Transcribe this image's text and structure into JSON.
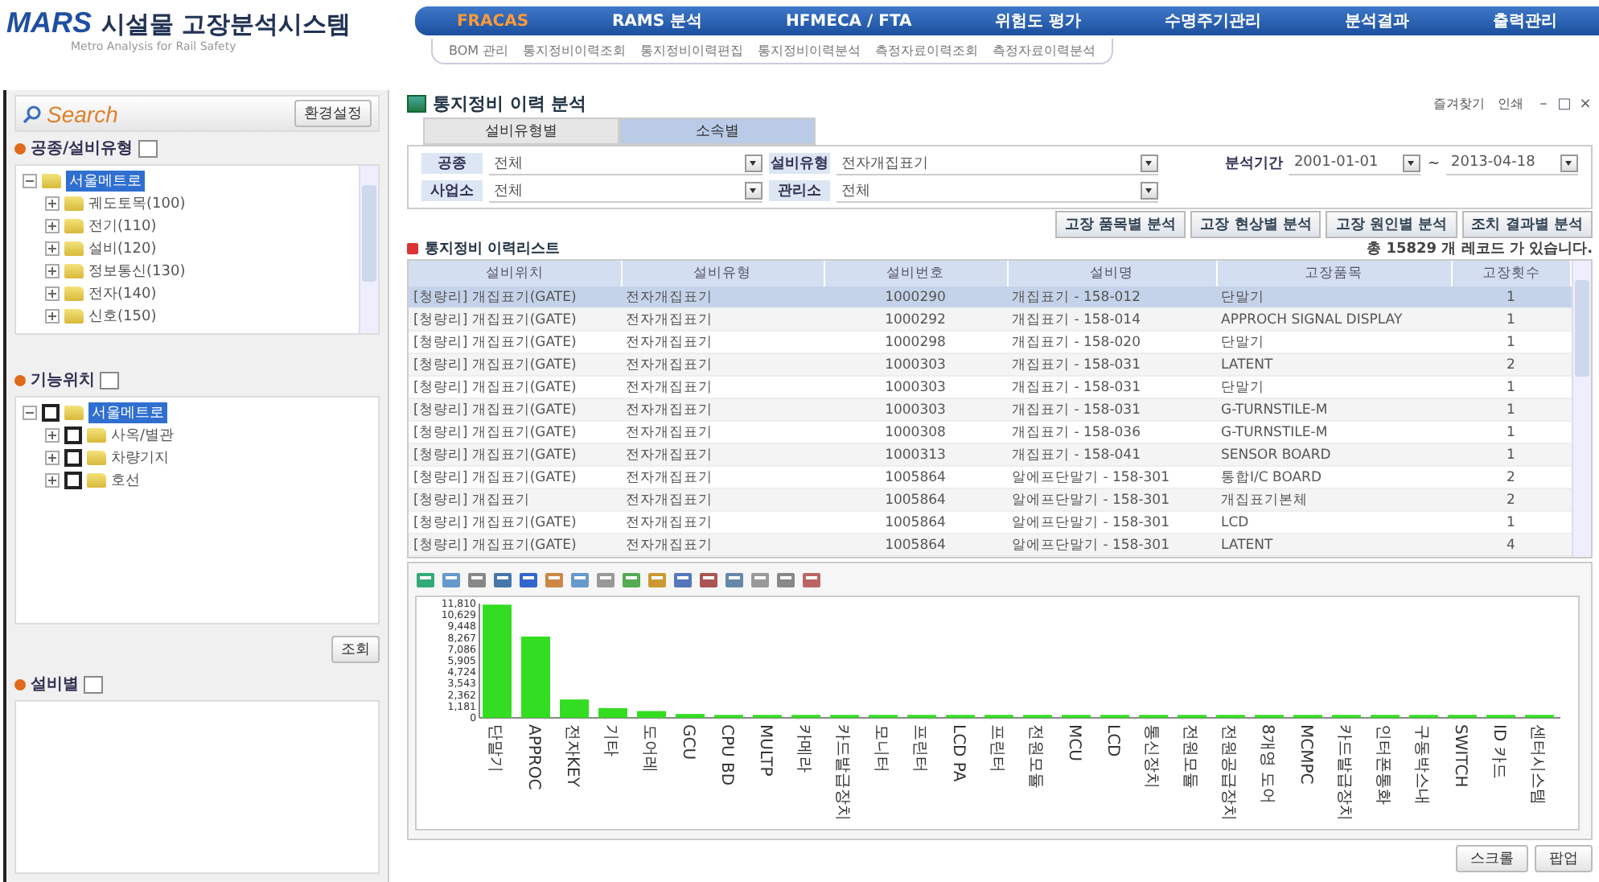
{
  "header": {
    "logo": "MARS",
    "title": "시설물 고장분석시스템",
    "subtitle": "Metro Analysis for Rail Safety",
    "nav": [
      {
        "label": "FRACAS",
        "selected": true
      },
      {
        "label": "RAMS 분석",
        "selected": false
      },
      {
        "label": "HFMECA / FTA",
        "selected": false
      },
      {
        "label": "위험도 평가",
        "selected": false
      },
      {
        "label": "수명주기관리",
        "selected": false
      },
      {
        "label": "분석결과",
        "selected": false
      },
      {
        "label": "출력관리",
        "selected": false
      }
    ],
    "subnav": [
      "BOM 관리",
      "통지정비이력조회",
      "통지정비이력편집",
      "통지정비이력분석",
      "측정자료이력조회",
      "측정자료이력분석"
    ]
  },
  "sidebar": {
    "search_title": "Search",
    "settings_button": "환경설정",
    "type_section": {
      "title": "공종/설비유형",
      "checked": false,
      "tree": {
        "label": "서울메트로",
        "selected": true,
        "expanded": true,
        "children": [
          {
            "label": "궤도토목(100)",
            "expanded": false
          },
          {
            "label": "전기(110)",
            "expanded": false
          },
          {
            "label": "설비(120)",
            "expanded": false
          },
          {
            "label": "정보통신(130)",
            "expanded": false
          },
          {
            "label": "전자(140)",
            "expanded": false
          },
          {
            "label": "신호(150)",
            "expanded": false
          }
        ]
      }
    },
    "location_section": {
      "title": "기능위치",
      "checked": false,
      "tree": {
        "label": "서울메트로",
        "selected": true,
        "expanded": true,
        "checked": false,
        "children": [
          {
            "label": "사옥/별관",
            "expanded": false,
            "checked": false
          },
          {
            "label": "차량기지",
            "expanded": false,
            "checked": false
          },
          {
            "label": "호선",
            "expanded": false,
            "checked": false
          }
        ]
      }
    },
    "query_button": "조회",
    "equipment_section": {
      "title": "설비별",
      "checked": false
    }
  },
  "panel": {
    "title": "통지정비 이력 분석",
    "links": [
      "즐겨찾기",
      "인쇄"
    ],
    "window_controls": [
      "–",
      "□",
      "×"
    ],
    "tabs": [
      {
        "label": "설비유형별",
        "selected": false
      },
      {
        "label": "소속별",
        "selected": true
      }
    ],
    "filter_rows": [
      [
        {
          "label": "공종",
          "value": "전체"
        },
        {
          "label": "설비유형",
          "value": "전자개집표기"
        }
      ],
      [
        {
          "label": "사업소",
          "value": "전체"
        },
        {
          "label": "관리소",
          "value": "전체"
        }
      ]
    ],
    "period": {
      "label": "분석기간",
      "from": "2001-01-01",
      "separator": "~",
      "to": "2013-04-18"
    },
    "analysis_buttons": [
      "고장 품목별 분석",
      "고장 현상별 분석",
      "고장 원인별 분석",
      "조치 결과별 분석"
    ],
    "list_title": "통지정비 이력리스트",
    "record_count": "총 15829 개 레코드 가 있습니다.",
    "table": {
      "columns": [
        "설비위치",
        "설비유형",
        "설비번호",
        "설비명",
        "고장품목",
        "고장횟수"
      ],
      "rows": [
        {
          "selected": true,
          "cells": [
            "[청량리] 개집표기(GATE)",
            "전자개집표기",
            "1000290",
            "개집표기 - 158-012",
            "단말기",
            "1"
          ]
        },
        {
          "selected": false,
          "cells": [
            "[청량리] 개집표기(GATE)",
            "전자개집표기",
            "1000292",
            "개집표기 - 158-014",
            "APPROCH SIGNAL DISPLAY",
            "1"
          ]
        },
        {
          "selected": false,
          "cells": [
            "[청량리] 개집표기(GATE)",
            "전자개집표기",
            "1000298",
            "개집표기 - 158-020",
            "단말기",
            "1"
          ]
        },
        {
          "selected": false,
          "cells": [
            "[청량리] 개집표기(GATE)",
            "전자개집표기",
            "1000303",
            "개집표기 - 158-031",
            "LATENT",
            "2"
          ]
        },
        {
          "selected": false,
          "cells": [
            "[청량리] 개집표기(GATE)",
            "전자개집표기",
            "1000303",
            "개집표기 - 158-031",
            "단말기",
            "1"
          ]
        },
        {
          "selected": false,
          "cells": [
            "[청량리] 개집표기(GATE)",
            "전자개집표기",
            "1000303",
            "개집표기 - 158-031",
            "G-TURNSTILE-M",
            "1"
          ]
        },
        {
          "selected": false,
          "cells": [
            "[청량리] 개집표기(GATE)",
            "전자개집표기",
            "1000308",
            "개집표기 - 158-036",
            "G-TURNSTILE-M",
            "1"
          ]
        },
        {
          "selected": false,
          "cells": [
            "[청량리] 개집표기(GATE)",
            "전자개집표기",
            "1000313",
            "개집표기 - 158-041",
            "SENSOR BOARD",
            "1"
          ]
        },
        {
          "selected": false,
          "cells": [
            "[청량리] 개집표기(GATE)",
            "전자개집표기",
            "1005864",
            "알에프단말기 - 158-301",
            "통합I/C BOARD",
            "2"
          ]
        },
        {
          "selected": false,
          "cells": [
            "[청량리] 개집표기",
            "전자개집표기",
            "1005864",
            "알에프단말기 - 158-301",
            "개집표기본체",
            "2"
          ]
        },
        {
          "selected": false,
          "cells": [
            "[청량리] 개집표기(GATE)",
            "전자개집표기",
            "1005864",
            "알에프단말기 - 158-301",
            "LCD",
            "1"
          ]
        },
        {
          "selected": false,
          "cells": [
            "[청량리] 개집표기(GATE)",
            "전자개집표기",
            "1005864",
            "알에프단말기 - 158-301",
            "LATENT",
            "4"
          ]
        }
      ]
    },
    "chart": {
      "chart_data": {
        "type": "bar",
        "color": "#33dd22",
        "categories": [
          "단말기",
          "APPROC",
          "전자KEY",
          "기타",
          "도어레",
          "GCU",
          "CPU BD",
          "MULTP",
          "카메라",
          "카드발급장치",
          "모니터",
          "프린터",
          "LCD PA",
          "프린터",
          "전원모듈",
          "MCU",
          "LCD",
          "통신장치",
          "전원모듈",
          "전원공급장치",
          "8개영 도어",
          "MCMPC",
          "카드발급장치",
          "인터폰통화",
          "구동박스내",
          "SWITCH",
          "ID 카드",
          "센터시스템"
        ],
        "values": [
          11700,
          8400,
          1900,
          1000,
          700,
          400,
          300,
          300,
          300,
          300,
          300,
          300,
          300,
          300,
          300,
          300,
          300,
          300,
          300,
          300,
          300,
          300,
          300,
          300,
          300,
          300,
          300,
          300
        ],
        "ylim": [
          0,
          11810
        ],
        "yticks": [
          {
            "value": 0,
            "label": "0"
          },
          {
            "value": 1181,
            "label": "1,181"
          },
          {
            "value": 2362,
            "label": "2,362"
          },
          {
            "value": 3543,
            "label": "3,543"
          },
          {
            "value": 4724,
            "label": "4,724"
          },
          {
            "value": 5905,
            "label": "5,905"
          },
          {
            "value": 7086,
            "label": "7,086"
          },
          {
            "value": 8267,
            "label": "8,267"
          },
          {
            "value": 9448,
            "label": "9,448"
          },
          {
            "value": 10629,
            "label": "10,629"
          },
          {
            "value": 11810,
            "label": "11,810"
          }
        ]
      }
    },
    "buttons": [
      "스크롤",
      "팝업"
    ]
  }
}
